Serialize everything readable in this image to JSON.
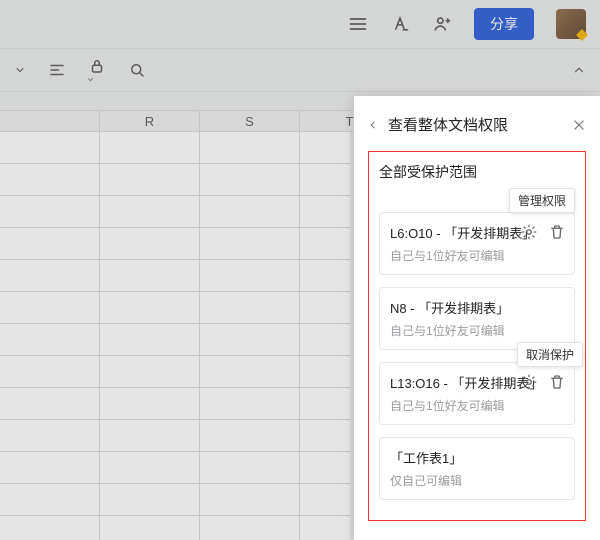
{
  "topbar": {
    "share_label": "分享"
  },
  "columns": [
    "R",
    "S",
    "T"
  ],
  "panel": {
    "title": "查看整体文档权限",
    "section_title": "全部受保护范围",
    "tooltip_manage": "管理权限",
    "tooltip_cancel": "取消保护",
    "items": [
      {
        "name": "L6:O10 - 「开发排期表」",
        "sub": "自己与1位好友可编辑",
        "show_actions": true
      },
      {
        "name": "N8 - 「开发排期表」",
        "sub": "自己与1位好友可编辑",
        "show_actions": false
      },
      {
        "name": "L13:O16 - 「开发排期表」",
        "sub": "自己与1位好友可编辑",
        "show_actions": true
      },
      {
        "name": "「工作表1」",
        "sub": "仅自己可编辑",
        "show_actions": false
      }
    ]
  }
}
